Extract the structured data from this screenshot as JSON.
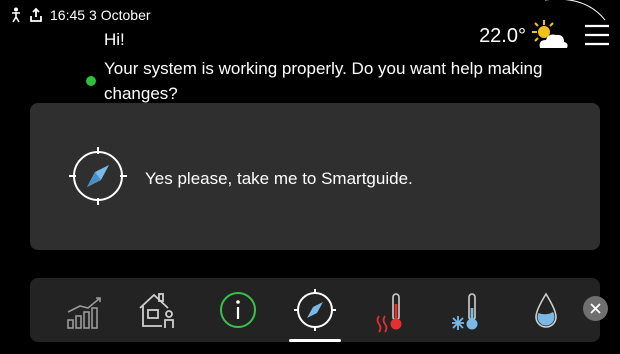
{
  "status_bar": {
    "icons": [
      "person-icon",
      "upload-icon"
    ],
    "time": "16:45",
    "date": "3 October"
  },
  "header": {
    "greeting": "Hi!",
    "message": "Your system is working properly. Do you want help making changes?",
    "status_color": "#2fbf3a",
    "temperature": "22.0°",
    "weather_icon": "partly-sunny-icon",
    "menu_icon": "hamburger-menu-icon"
  },
  "panel": {
    "icon": "compass-icon",
    "text": "Yes please, take me to Smartguide."
  },
  "dock": {
    "items": [
      "statistics-icon",
      "home-person-icon",
      "info-icon",
      "compass-icon",
      "heating-thermometer-icon",
      "cooling-thermometer-icon",
      "water-drop-icon"
    ],
    "active_index": 3,
    "close_icon": "close-icon"
  },
  "colors": {
    "accent_green": "#2fbf3a",
    "heating_red": "#e2312e",
    "panel_bg": "#2f2f2f",
    "dock_bg": "#232323"
  }
}
